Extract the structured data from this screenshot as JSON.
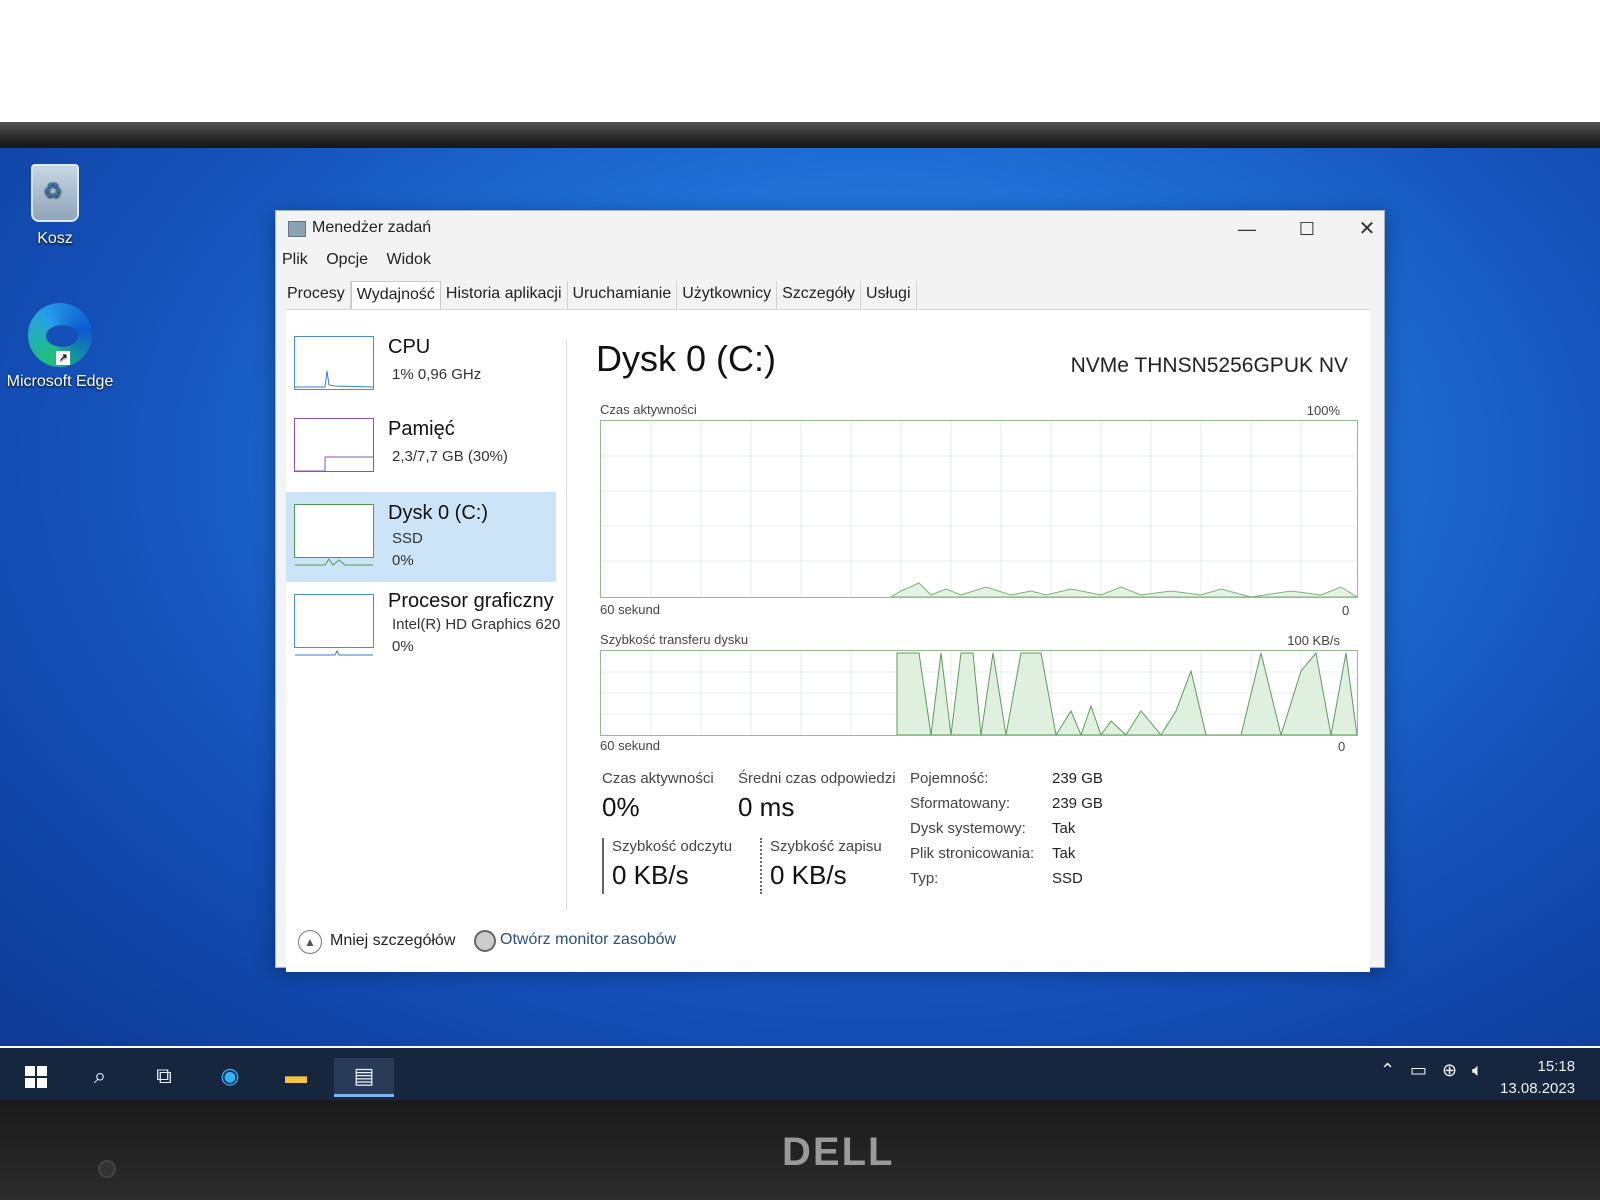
{
  "desktop": {
    "icons": [
      {
        "label": "Kosz",
        "icon": "recycle-bin-icon"
      },
      {
        "label": "Microsoft Edge",
        "icon": "edge-icon"
      }
    ]
  },
  "window": {
    "title": "Menedżer zadań",
    "controls": {
      "minimize": "—",
      "maximize": "☐",
      "close": "✕"
    },
    "menu": [
      "Plik",
      "Opcje",
      "Widok"
    ],
    "tabs": [
      "Procesy",
      "Wydajność",
      "Historia aplikacji",
      "Uruchamianie",
      "Użytkownicy",
      "Szczegóły",
      "Usługi"
    ],
    "active_tab": "Wydajność"
  },
  "resources": [
    {
      "name": "CPU",
      "line1": "1% 0,96 GHz",
      "line2": ""
    },
    {
      "name": "Pamięć",
      "line1": "2,3/7,7 GB (30%)",
      "line2": ""
    },
    {
      "name": "Dysk 0 (C:)",
      "line1": "SSD",
      "line2": "0%"
    },
    {
      "name": "Procesor graficzny",
      "line1": "Intel(R) HD Graphics 620",
      "line2": "0%"
    }
  ],
  "detail": {
    "title": "Dysk 0 (C:)",
    "model": "NVMe THNSN5256GPUK NV",
    "graph1": {
      "label": "Czas aktywności",
      "max": "100%",
      "left": "60 sekund",
      "right": "0"
    },
    "graph2": {
      "label": "Szybkość transferu dysku",
      "max": "100 KB/s",
      "left": "60 sekund",
      "right": "0"
    },
    "stats": {
      "active_label": "Czas aktywności",
      "active_value": "0%",
      "resp_label": "Średni czas odpowiedzi",
      "resp_value": "0 ms",
      "read_label": "Szybkość odczytu",
      "read_value": "0 KB/s",
      "write_label": "Szybkość zapisu",
      "write_value": "0 KB/s"
    },
    "info": [
      {
        "k": "Pojemność:",
        "v": "239 GB"
      },
      {
        "k": "Sformatowany:",
        "v": "239 GB"
      },
      {
        "k": "Dysk systemowy:",
        "v": "Tak"
      },
      {
        "k": "Plik stronicowania:",
        "v": "Tak"
      },
      {
        "k": "Typ:",
        "v": "SSD"
      }
    ]
  },
  "footer": {
    "less": "Mniej szczegółów",
    "monitor": "Otwórz monitor zasobów"
  },
  "taskbar": {
    "time": "15:18",
    "date": "13.08.2023"
  },
  "colors": {
    "selected": "#cce4f7",
    "graph_line": "#4f9a4f",
    "graph_fill": "#d9f0d9",
    "taskbar": "#16263f"
  }
}
